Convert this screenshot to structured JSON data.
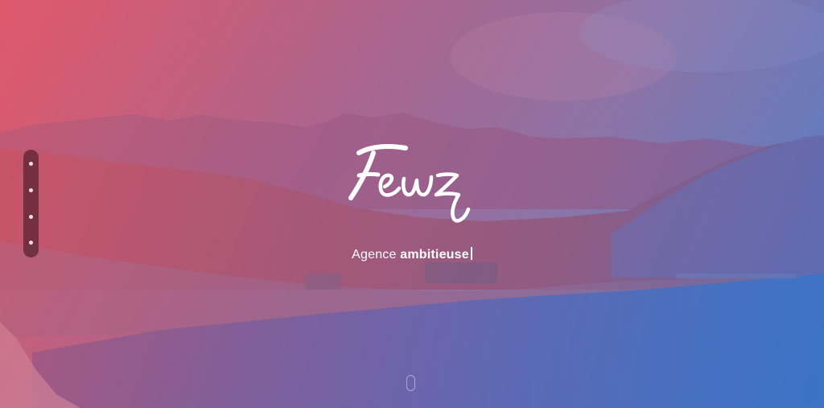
{
  "brand": {
    "logo_text": "Fewz"
  },
  "tagline": {
    "prefix": "Agence",
    "emphasis": "ambitieuse",
    "cursor": "|"
  },
  "side_nav": {
    "dot_count": 4,
    "active_index": 0
  },
  "icons": {
    "scroll": "mouse-scroll-icon"
  },
  "colors": {
    "gradient_left": "#e85464",
    "gradient_right": "#3a70c8",
    "text": "#ffffff",
    "nav_pill": "#46192a"
  }
}
